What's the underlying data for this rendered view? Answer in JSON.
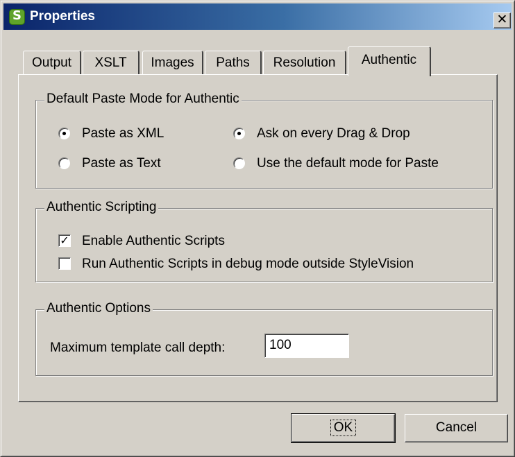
{
  "window": {
    "title": "Properties",
    "icon": "stylevision-app-icon",
    "close_glyph": "✕"
  },
  "tabs": [
    {
      "label": "Output",
      "active": false
    },
    {
      "label": "XSLT",
      "active": false
    },
    {
      "label": "Images",
      "active": false
    },
    {
      "label": "Paths",
      "active": false
    },
    {
      "label": "Resolution",
      "active": false
    },
    {
      "label": "Authentic",
      "active": true
    }
  ],
  "paste_mode": {
    "legend": "Default Paste Mode for Authentic",
    "options": [
      {
        "label": "Paste as XML",
        "selected": true
      },
      {
        "label": "Paste as Text",
        "selected": false
      },
      {
        "label": "Ask on every Drag & Drop",
        "selected": true
      },
      {
        "label": "Use the default mode for Paste",
        "selected": false
      }
    ]
  },
  "scripting": {
    "legend": "Authentic Scripting",
    "checkboxes": [
      {
        "label": "Enable Authentic Scripts",
        "checked": true,
        "mark": "✓"
      },
      {
        "label": "Run Authentic Scripts in debug mode outside StyleVision",
        "checked": false,
        "mark": ""
      }
    ]
  },
  "options": {
    "legend": "Authentic Options",
    "depth_label": "Maximum template call depth:",
    "depth_value": "100"
  },
  "buttons": {
    "ok": "OK",
    "cancel": "Cancel"
  }
}
